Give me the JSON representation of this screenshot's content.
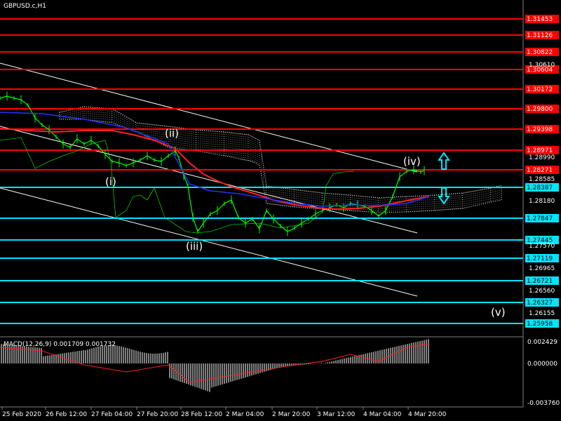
{
  "title": "GBPUSD.c,H1",
  "indicator_label": "MACD(12,26,9) 0.001709 0.001732",
  "colors": {
    "background": "#000000",
    "resistance": "#ff0000",
    "support": "#00e5ff",
    "price": "#00ff00",
    "channel": "#ffffff",
    "ma": "#ff2020",
    "ma2": "#2233ff",
    "ichimoku": "#ffffff",
    "arrow": "#00e5ff",
    "histogram": "#ffffff"
  },
  "price_levels": {
    "red": [
      "1.31453",
      "1.31126",
      "1.30822",
      "1.30604",
      "1.30172",
      "1.29800",
      "1.29398",
      "1.28971",
      "1.28271"
    ],
    "cyan": [
      "1.28387",
      "1.27847",
      "1.27445",
      "1.27119",
      "1.26721",
      "1.26327",
      "1.25958"
    ]
  },
  "price_ticks": [
    "1.30610",
    "1.28990",
    "1.28585",
    "1.28180",
    "1.27570",
    "1.26965",
    "1.26560",
    "1.26155"
  ],
  "macd_ticks": [
    "0.002429",
    "0.000000",
    "-0.003760"
  ],
  "wave_labels": [
    "(i)",
    "(ii)",
    "(iii)",
    "(iv)",
    "(v)"
  ],
  "time_labels": [
    "25 Feb 2020",
    "26 Feb 12:00",
    "27 Feb 04:00",
    "27 Feb 20:00",
    "28 Feb 12:00",
    "2 Mar 04:00",
    "2 Mar 20:00",
    "3 Mar 12:00",
    "4 Mar 04:00",
    "4 Mar 20:00"
  ],
  "arrows": {
    "up": "up-arrow-icon",
    "down": "down-arrow-icon"
  }
}
